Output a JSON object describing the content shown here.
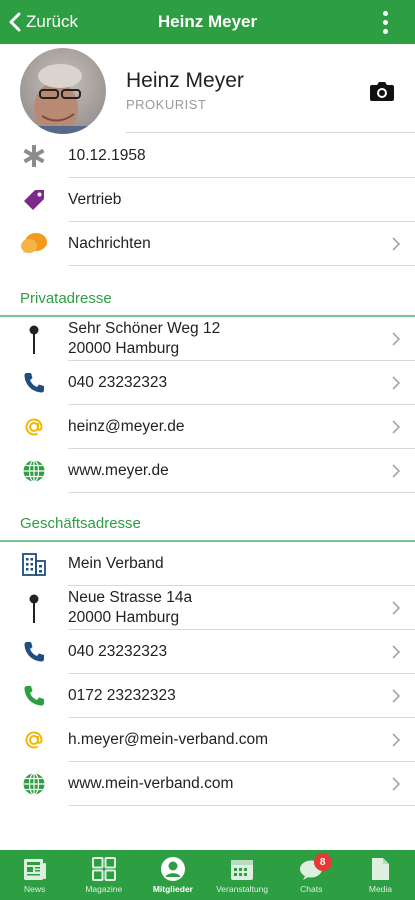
{
  "header": {
    "back_label": "Zurück",
    "title": "Heinz Meyer"
  },
  "profile": {
    "name": "Heinz Meyer",
    "role": "PROKURIST"
  },
  "info": {
    "birthday": "10.12.1958",
    "department": "Vertrieb",
    "messages": "Nachrichten"
  },
  "private_address": {
    "title": "Privatadresse",
    "street": "Sehr Schöner Weg 12",
    "city": "20000 Hamburg",
    "phone": "040 23232323",
    "email": "heinz@meyer.de",
    "website": "www.meyer.de"
  },
  "business_address": {
    "title": "Geschäftsadresse",
    "company": "Mein Verband",
    "street": "Neue Strasse 14a",
    "city": "20000 Hamburg",
    "phone": "040 23232323",
    "mobile": "0172 23232323",
    "email": "h.meyer@mein-verband.com",
    "website": "www.mein-verband.com"
  },
  "bottom_nav": {
    "items": [
      {
        "label": "News",
        "icon": "news-icon"
      },
      {
        "label": "Magazine",
        "icon": "grid-icon"
      },
      {
        "label": "Mitglieder",
        "icon": "person-icon"
      },
      {
        "label": "Veranstaltung",
        "icon": "calendar-icon"
      },
      {
        "label": "Chats",
        "icon": "chat-icon",
        "badge": "8"
      },
      {
        "label": "Media",
        "icon": "document-icon"
      }
    ],
    "active": "Mitglieder"
  },
  "colors": {
    "brand_green": "#2e9e43",
    "section_green": "#2e9e43",
    "tag_purple": "#7b2a8c",
    "chat_orange": "#f39a1e",
    "phone_blue": "#1f4f82",
    "email_yellow": "#f2b705",
    "badge_red": "#e53935"
  }
}
